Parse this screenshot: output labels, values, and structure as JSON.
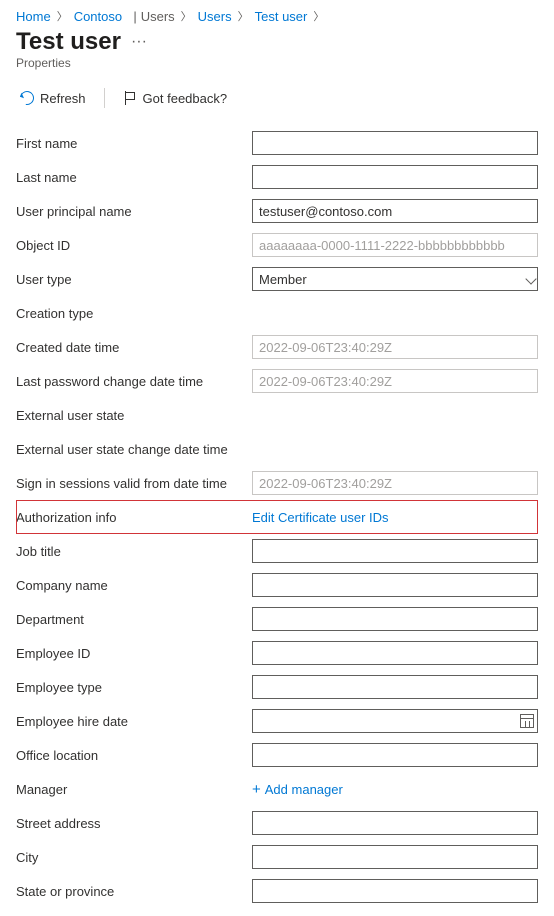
{
  "breadcrumb": {
    "home": "Home",
    "tenant": "Contoso",
    "section": "Users",
    "subsection": "Users",
    "current": "Test user"
  },
  "header": {
    "title": "Test user",
    "subtitle": "Properties"
  },
  "toolbar": {
    "refresh": "Refresh",
    "feedback": "Got feedback?"
  },
  "fields": {
    "first_name": {
      "label": "First name",
      "value": ""
    },
    "last_name": {
      "label": "Last name",
      "value": ""
    },
    "upn": {
      "label": "User principal name",
      "value": "testuser@contoso.com"
    },
    "object_id": {
      "label": "Object ID",
      "value": "aaaaaaaa-0000-1111-2222-bbbbbbbbbbbb"
    },
    "user_type": {
      "label": "User type",
      "value": "Member"
    },
    "creation_type": {
      "label": "Creation type",
      "value": ""
    },
    "created": {
      "label": "Created date time",
      "value": "2022-09-06T23:40:29Z"
    },
    "pwd_change": {
      "label": "Last password change date time",
      "value": "2022-09-06T23:40:29Z"
    },
    "ext_state": {
      "label": "External user state",
      "value": ""
    },
    "ext_state_change": {
      "label": "External user state change date time",
      "value": ""
    },
    "sign_in_valid": {
      "label": "Sign in sessions valid from date time",
      "value": "2022-09-06T23:40:29Z"
    },
    "auth_info": {
      "label": "Authorization info",
      "link": "Edit Certificate user IDs"
    },
    "job_title": {
      "label": "Job title",
      "value": ""
    },
    "company": {
      "label": "Company name",
      "value": ""
    },
    "department": {
      "label": "Department",
      "value": ""
    },
    "employee_id": {
      "label": "Employee ID",
      "value": ""
    },
    "employee_type": {
      "label": "Employee type",
      "value": ""
    },
    "hire_date": {
      "label": "Employee hire date",
      "value": ""
    },
    "office": {
      "label": "Office location",
      "value": ""
    },
    "manager": {
      "label": "Manager",
      "link": "Add manager"
    },
    "street": {
      "label": "Street address",
      "value": ""
    },
    "city": {
      "label": "City",
      "value": ""
    },
    "state": {
      "label": "State or province",
      "value": ""
    }
  }
}
